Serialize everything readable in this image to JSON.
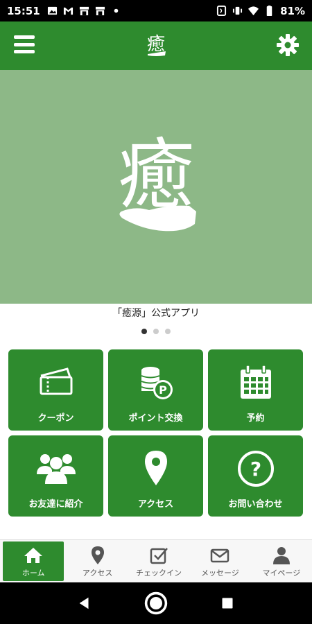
{
  "status_bar": {
    "time": "15:51",
    "battery": "81%",
    "notification_icons": [
      "image-icon",
      "gmail-icon",
      "shop-icon",
      "shop-icon",
      "dot-icon"
    ],
    "system_icons": [
      "nfc-icon",
      "vibrate-icon",
      "wifi-icon",
      "battery-icon"
    ]
  },
  "header": {
    "menu_icon": "hamburger-icon",
    "logo": "癒-logo",
    "settings_icon": "gear-icon",
    "bg_color": "#2e8b2e"
  },
  "hero": {
    "caption": "「癒源」公式アプリ",
    "slides": 3,
    "active_slide": 1,
    "bg_color": "#8db887"
  },
  "menu_tiles": [
    {
      "label": "クーポン",
      "icon": "coupon-icon"
    },
    {
      "label": "ポイント交換",
      "icon": "coins-icon"
    },
    {
      "label": "予約",
      "icon": "calendar-icon"
    },
    {
      "label": "お友達に紹介",
      "icon": "people-icon"
    },
    {
      "label": "アクセス",
      "icon": "map-pin-icon"
    },
    {
      "label": "お問い合わせ",
      "icon": "question-icon"
    }
  ],
  "tabs": [
    {
      "label": "ホーム",
      "icon": "home-icon",
      "active": true
    },
    {
      "label": "アクセス",
      "icon": "map-pin-icon",
      "active": false
    },
    {
      "label": "チェックイン",
      "icon": "checkin-icon",
      "active": false
    },
    {
      "label": "メッセージ",
      "icon": "mail-icon",
      "active": false
    },
    {
      "label": "マイページ",
      "icon": "user-icon",
      "active": false
    }
  ]
}
